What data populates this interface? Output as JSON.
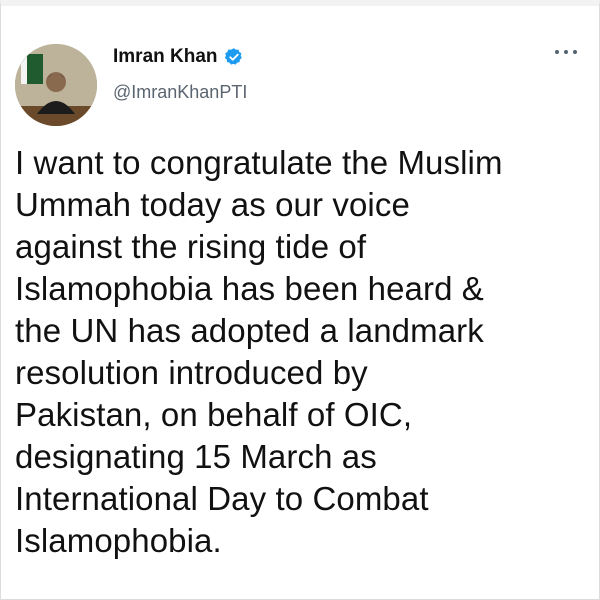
{
  "author": {
    "display_name": "Imran Khan",
    "handle": "@ImranKhanPTI",
    "verified": true,
    "verified_color": "#1d9bf0"
  },
  "menu": {
    "icon": "more-horizontal-icon"
  },
  "tweet": {
    "text": "I want to congratulate the Muslim\nUmmah today as our voice\nagainst the rising tide of\nIslamophobia has been heard &\nthe UN has adopted a landmark\nresolution introduced by\nPakistan, on behalf of OIC,\ndesignating 15 March as\nInternational Day to Combat\nIslamophobia."
  }
}
